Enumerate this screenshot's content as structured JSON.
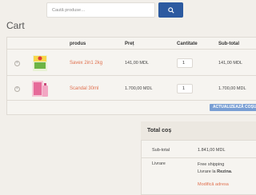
{
  "search": {
    "placeholder": "Caută produse…"
  },
  "page": {
    "title": "Cart"
  },
  "table": {
    "headers": {
      "product": "produs",
      "price": "Preț",
      "quantity": "Cantitate",
      "subtotal": "Sub-total"
    },
    "rows": [
      {
        "name": "Savex 2in1 2kg",
        "price": "141,00 MDL",
        "qty": "1",
        "subtotal": "141,00 MDL"
      },
      {
        "name": "Scandal 30ml",
        "price": "1.700,00 MDL",
        "qty": "1",
        "subtotal": "1.700,00 MDL"
      }
    ],
    "update_label": "ACTUALIZEAZĂ COȘUL"
  },
  "totals": {
    "title": "Total coș",
    "subtotal_label": "Sub-total",
    "subtotal_value": "1.841,00 MDL",
    "shipping_label": "Livrare",
    "shipping_option": "Free shipping",
    "shipping_to_prefix": "Livrare la",
    "shipping_to_place": "Rezina",
    "shipping_to_suffix": ".",
    "change_address": "Modifică adresa"
  },
  "colors": {
    "accent": "#e0704e",
    "primary": "#2c5aa0",
    "update_button": "#7a9fd4"
  }
}
